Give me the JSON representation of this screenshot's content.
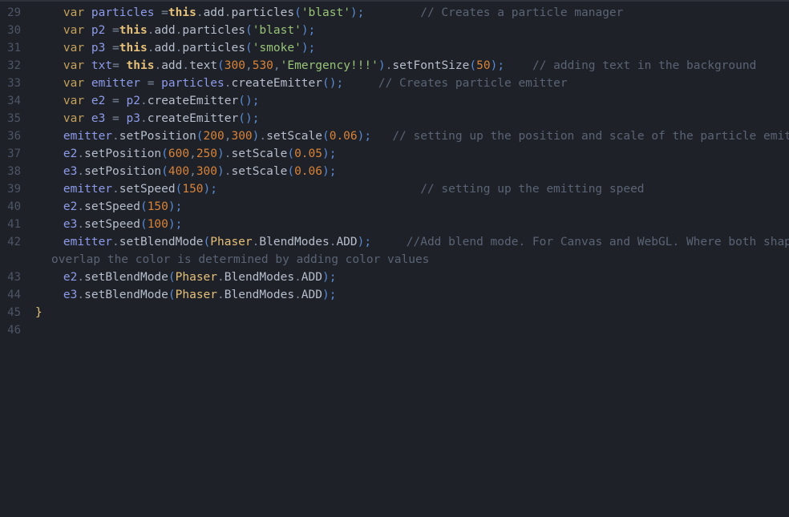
{
  "editor": {
    "language": "javascript",
    "theme": "one-dark",
    "background_color": "#1e2127",
    "gutter_color": "#4d5566",
    "first_line_number": 29,
    "last_line_number": 46,
    "wrap_enabled": true,
    "colors": {
      "keyword": "#d19a66",
      "var_keyword": "#c5a25c",
      "this_keyword": "#e5c07b",
      "variable": "#8d9bea",
      "property": "#b6bdcc",
      "class": "#e5c07b",
      "string": "#98c379",
      "number": "#d8833a",
      "punctuation": "#5b8ad1",
      "dot": "#7a8699",
      "comment": "#5b6475",
      "brace": "#e5c07b",
      "plain": "#abb2bf"
    }
  },
  "lines": [
    {
      "number": "29",
      "tokens": [
        {
          "t": "    ",
          "c": "plain"
        },
        {
          "t": "var",
          "c": "var"
        },
        {
          "t": " ",
          "c": "plain"
        },
        {
          "t": "particles",
          "c": "variable"
        },
        {
          "t": " =",
          "c": "operator"
        },
        {
          "t": "this",
          "c": "this"
        },
        {
          "t": ".",
          "c": "dot"
        },
        {
          "t": "add",
          "c": "property"
        },
        {
          "t": ".",
          "c": "dot"
        },
        {
          "t": "particles",
          "c": "property"
        },
        {
          "t": "(",
          "c": "punct"
        },
        {
          "t": "'blast'",
          "c": "string"
        },
        {
          "t": ")",
          "c": "punct"
        },
        {
          "t": ";",
          "c": "punct"
        },
        {
          "t": "        ",
          "c": "plain"
        },
        {
          "t": "// Creates a particle manager",
          "c": "comment"
        }
      ]
    },
    {
      "number": "30",
      "tokens": [
        {
          "t": "    ",
          "c": "plain"
        },
        {
          "t": "var",
          "c": "var"
        },
        {
          "t": " ",
          "c": "plain"
        },
        {
          "t": "p2",
          "c": "variable"
        },
        {
          "t": " =",
          "c": "operator"
        },
        {
          "t": "this",
          "c": "this"
        },
        {
          "t": ".",
          "c": "dot"
        },
        {
          "t": "add",
          "c": "property"
        },
        {
          "t": ".",
          "c": "dot"
        },
        {
          "t": "particles",
          "c": "property"
        },
        {
          "t": "(",
          "c": "punct"
        },
        {
          "t": "'blast'",
          "c": "string"
        },
        {
          "t": ")",
          "c": "punct"
        },
        {
          "t": ";",
          "c": "punct"
        }
      ]
    },
    {
      "number": "31",
      "tokens": [
        {
          "t": "    ",
          "c": "plain"
        },
        {
          "t": "var",
          "c": "var"
        },
        {
          "t": " ",
          "c": "plain"
        },
        {
          "t": "p3",
          "c": "variable"
        },
        {
          "t": " =",
          "c": "operator"
        },
        {
          "t": "this",
          "c": "this"
        },
        {
          "t": ".",
          "c": "dot"
        },
        {
          "t": "add",
          "c": "property"
        },
        {
          "t": ".",
          "c": "dot"
        },
        {
          "t": "particles",
          "c": "property"
        },
        {
          "t": "(",
          "c": "punct"
        },
        {
          "t": "'smoke'",
          "c": "string"
        },
        {
          "t": ")",
          "c": "punct"
        },
        {
          "t": ";",
          "c": "punct"
        }
      ]
    },
    {
      "number": "32",
      "tokens": [
        {
          "t": "    ",
          "c": "plain"
        },
        {
          "t": "var",
          "c": "var"
        },
        {
          "t": " ",
          "c": "plain"
        },
        {
          "t": "txt",
          "c": "variable"
        },
        {
          "t": "=",
          "c": "operator"
        },
        {
          "t": " ",
          "c": "plain"
        },
        {
          "t": "this",
          "c": "this"
        },
        {
          "t": ".",
          "c": "dot"
        },
        {
          "t": "add",
          "c": "property"
        },
        {
          "t": ".",
          "c": "dot"
        },
        {
          "t": "text",
          "c": "property"
        },
        {
          "t": "(",
          "c": "punct"
        },
        {
          "t": "300",
          "c": "number"
        },
        {
          "t": ",",
          "c": "dot"
        },
        {
          "t": "530",
          "c": "number"
        },
        {
          "t": ",",
          "c": "dot"
        },
        {
          "t": "'Emergency!!!'",
          "c": "string"
        },
        {
          "t": ")",
          "c": "punct"
        },
        {
          "t": ".",
          "c": "dot"
        },
        {
          "t": "setFontSize",
          "c": "method"
        },
        {
          "t": "(",
          "c": "punct"
        },
        {
          "t": "50",
          "c": "number"
        },
        {
          "t": ")",
          "c": "punct"
        },
        {
          "t": ";",
          "c": "punct"
        },
        {
          "t": "    ",
          "c": "plain"
        },
        {
          "t": "// adding text in the background",
          "c": "comment"
        }
      ]
    },
    {
      "number": "33",
      "tokens": [
        {
          "t": "    ",
          "c": "plain"
        },
        {
          "t": "var",
          "c": "var"
        },
        {
          "t": " ",
          "c": "plain"
        },
        {
          "t": "emitter",
          "c": "variable"
        },
        {
          "t": " = ",
          "c": "operator"
        },
        {
          "t": "particles",
          "c": "variable"
        },
        {
          "t": ".",
          "c": "dot"
        },
        {
          "t": "createEmitter",
          "c": "method"
        },
        {
          "t": "(",
          "c": "punct"
        },
        {
          "t": ")",
          "c": "punct"
        },
        {
          "t": ";",
          "c": "punct"
        },
        {
          "t": "     ",
          "c": "plain"
        },
        {
          "t": "// Creates particle emitter",
          "c": "comment"
        }
      ]
    },
    {
      "number": "34",
      "tokens": [
        {
          "t": "    ",
          "c": "plain"
        },
        {
          "t": "var",
          "c": "var"
        },
        {
          "t": " ",
          "c": "plain"
        },
        {
          "t": "e2",
          "c": "variable"
        },
        {
          "t": " = ",
          "c": "operator"
        },
        {
          "t": "p2",
          "c": "variable"
        },
        {
          "t": ".",
          "c": "dot"
        },
        {
          "t": "createEmitter",
          "c": "method"
        },
        {
          "t": "(",
          "c": "punct"
        },
        {
          "t": ")",
          "c": "punct"
        },
        {
          "t": ";",
          "c": "punct"
        }
      ]
    },
    {
      "number": "35",
      "tokens": [
        {
          "t": "    ",
          "c": "plain"
        },
        {
          "t": "var",
          "c": "var"
        },
        {
          "t": " ",
          "c": "plain"
        },
        {
          "t": "e3",
          "c": "variable"
        },
        {
          "t": " = ",
          "c": "operator"
        },
        {
          "t": "p3",
          "c": "variable"
        },
        {
          "t": ".",
          "c": "dot"
        },
        {
          "t": "createEmitter",
          "c": "method"
        },
        {
          "t": "(",
          "c": "punct"
        },
        {
          "t": ")",
          "c": "punct"
        },
        {
          "t": ";",
          "c": "punct"
        }
      ]
    },
    {
      "number": "36",
      "tokens": [
        {
          "t": "    ",
          "c": "plain"
        },
        {
          "t": "emitter",
          "c": "variable"
        },
        {
          "t": ".",
          "c": "dot"
        },
        {
          "t": "setPosition",
          "c": "method"
        },
        {
          "t": "(",
          "c": "punct"
        },
        {
          "t": "200",
          "c": "number"
        },
        {
          "t": ",",
          "c": "dot"
        },
        {
          "t": "300",
          "c": "number"
        },
        {
          "t": ")",
          "c": "punct"
        },
        {
          "t": ".",
          "c": "dot"
        },
        {
          "t": "setScale",
          "c": "method"
        },
        {
          "t": "(",
          "c": "punct"
        },
        {
          "t": "0.06",
          "c": "number"
        },
        {
          "t": ")",
          "c": "punct"
        },
        {
          "t": ";",
          "c": "punct"
        },
        {
          "t": "   ",
          "c": "plain"
        },
        {
          "t": "// setting up the position and scale of the particle emitter",
          "c": "comment"
        }
      ]
    },
    {
      "number": "37",
      "tokens": [
        {
          "t": "    ",
          "c": "plain"
        },
        {
          "t": "e2",
          "c": "variable"
        },
        {
          "t": ".",
          "c": "dot"
        },
        {
          "t": "setPosition",
          "c": "method"
        },
        {
          "t": "(",
          "c": "punct"
        },
        {
          "t": "600",
          "c": "number"
        },
        {
          "t": ",",
          "c": "dot"
        },
        {
          "t": "250",
          "c": "number"
        },
        {
          "t": ")",
          "c": "punct"
        },
        {
          "t": ".",
          "c": "dot"
        },
        {
          "t": "setScale",
          "c": "method"
        },
        {
          "t": "(",
          "c": "punct"
        },
        {
          "t": "0.05",
          "c": "number"
        },
        {
          "t": ")",
          "c": "punct"
        },
        {
          "t": ";",
          "c": "punct"
        }
      ]
    },
    {
      "number": "38",
      "tokens": [
        {
          "t": "    ",
          "c": "plain"
        },
        {
          "t": "e3",
          "c": "variable"
        },
        {
          "t": ".",
          "c": "dot"
        },
        {
          "t": "setPosition",
          "c": "method"
        },
        {
          "t": "(",
          "c": "punct"
        },
        {
          "t": "400",
          "c": "number"
        },
        {
          "t": ",",
          "c": "dot"
        },
        {
          "t": "300",
          "c": "number"
        },
        {
          "t": ")",
          "c": "punct"
        },
        {
          "t": ".",
          "c": "dot"
        },
        {
          "t": "setScale",
          "c": "method"
        },
        {
          "t": "(",
          "c": "punct"
        },
        {
          "t": "0.06",
          "c": "number"
        },
        {
          "t": ")",
          "c": "punct"
        },
        {
          "t": ";",
          "c": "punct"
        }
      ]
    },
    {
      "number": "39",
      "tokens": [
        {
          "t": "    ",
          "c": "plain"
        },
        {
          "t": "emitter",
          "c": "variable"
        },
        {
          "t": ".",
          "c": "dot"
        },
        {
          "t": "setSpeed",
          "c": "method"
        },
        {
          "t": "(",
          "c": "punct"
        },
        {
          "t": "150",
          "c": "number"
        },
        {
          "t": ")",
          "c": "punct"
        },
        {
          "t": ";",
          "c": "punct"
        },
        {
          "t": "                             ",
          "c": "plain"
        },
        {
          "t": "// setting up the emitting speed",
          "c": "comment"
        }
      ]
    },
    {
      "number": "40",
      "tokens": [
        {
          "t": "    ",
          "c": "plain"
        },
        {
          "t": "e2",
          "c": "variable"
        },
        {
          "t": ".",
          "c": "dot"
        },
        {
          "t": "setSpeed",
          "c": "method"
        },
        {
          "t": "(",
          "c": "punct"
        },
        {
          "t": "150",
          "c": "number"
        },
        {
          "t": ")",
          "c": "punct"
        },
        {
          "t": ";",
          "c": "punct"
        }
      ]
    },
    {
      "number": "41",
      "tokens": [
        {
          "t": "    ",
          "c": "plain"
        },
        {
          "t": "e3",
          "c": "variable"
        },
        {
          "t": ".",
          "c": "dot"
        },
        {
          "t": "setSpeed",
          "c": "method"
        },
        {
          "t": "(",
          "c": "punct"
        },
        {
          "t": "100",
          "c": "number"
        },
        {
          "t": ")",
          "c": "punct"
        },
        {
          "t": ";",
          "c": "punct"
        }
      ]
    },
    {
      "number": "42",
      "tokens": [
        {
          "t": "    ",
          "c": "plain"
        },
        {
          "t": "emitter",
          "c": "variable"
        },
        {
          "t": ".",
          "c": "dot"
        },
        {
          "t": "setBlendMode",
          "c": "method"
        },
        {
          "t": "(",
          "c": "punct"
        },
        {
          "t": "Phaser",
          "c": "class"
        },
        {
          "t": ".",
          "c": "dot"
        },
        {
          "t": "BlendModes",
          "c": "property"
        },
        {
          "t": ".",
          "c": "dot"
        },
        {
          "t": "ADD",
          "c": "property"
        },
        {
          "t": ")",
          "c": "punct"
        },
        {
          "t": ";",
          "c": "punct"
        },
        {
          "t": "     ",
          "c": "plain"
        },
        {
          "t": "//Add blend mode. For Canvas and WebGL. Where both shapes",
          "c": "comment"
        }
      ]
    },
    {
      "number": "",
      "wrapped": true,
      "tokens": [
        {
          "t": "overlap the color is determined by adding color values",
          "c": "comment"
        }
      ]
    },
    {
      "number": "43",
      "tokens": [
        {
          "t": "    ",
          "c": "plain"
        },
        {
          "t": "e2",
          "c": "variable"
        },
        {
          "t": ".",
          "c": "dot"
        },
        {
          "t": "setBlendMode",
          "c": "method"
        },
        {
          "t": "(",
          "c": "punct"
        },
        {
          "t": "Phaser",
          "c": "class"
        },
        {
          "t": ".",
          "c": "dot"
        },
        {
          "t": "BlendModes",
          "c": "property"
        },
        {
          "t": ".",
          "c": "dot"
        },
        {
          "t": "ADD",
          "c": "property"
        },
        {
          "t": ")",
          "c": "punct"
        },
        {
          "t": ";",
          "c": "punct"
        }
      ]
    },
    {
      "number": "44",
      "tokens": [
        {
          "t": "    ",
          "c": "plain"
        },
        {
          "t": "e3",
          "c": "variable"
        },
        {
          "t": ".",
          "c": "dot"
        },
        {
          "t": "setBlendMode",
          "c": "method"
        },
        {
          "t": "(",
          "c": "punct"
        },
        {
          "t": "Phaser",
          "c": "class"
        },
        {
          "t": ".",
          "c": "dot"
        },
        {
          "t": "BlendModes",
          "c": "property"
        },
        {
          "t": ".",
          "c": "dot"
        },
        {
          "t": "ADD",
          "c": "property"
        },
        {
          "t": ")",
          "c": "punct"
        },
        {
          "t": ";",
          "c": "punct"
        }
      ]
    },
    {
      "number": "45",
      "tokens": [
        {
          "t": "}",
          "c": "brace"
        }
      ]
    },
    {
      "number": "46",
      "tokens": []
    }
  ]
}
